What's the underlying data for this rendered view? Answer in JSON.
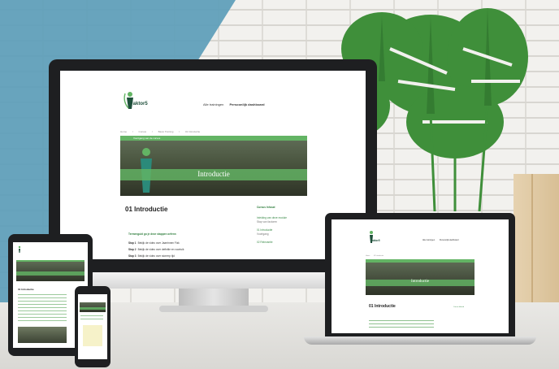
{
  "site": {
    "brand": "Faktor5",
    "nav": [
      {
        "label": "Alle trainingen"
      },
      {
        "label": "Persoonlijk dashboard"
      }
    ],
    "breadcrumbs": [
      "Home",
      "/",
      "Cursus",
      "/",
      "Basis Training",
      "/",
      "01 Introductie"
    ],
    "progress_label": "Voortgang van de cursus",
    "hero_title": "Introductie",
    "page_title": "01 Introductie",
    "subhead": "Termenguid go je deze stappen oefenn",
    "steps": [
      {
        "label": "Stap 1",
        "text": "Bekijk de video over Jaarrinnen Fizk"
      },
      {
        "label": "Stap 2",
        "text": "Bekijk de video over definitie en voortuik"
      },
      {
        "label": "Stap 3",
        "text": "Bekijk de video over storrerp tijd"
      }
    ],
    "sidebar": {
      "heading": "Cursus Inhoud",
      "items": [
        {
          "label": "Inleiding van deze module",
          "meta": "Stap van factoren"
        },
        {
          "label": "01 Introductie",
          "meta": "Voortgang"
        },
        {
          "label": "02 Relevantie",
          "meta": ""
        }
      ]
    }
  },
  "colors": {
    "accent_green": "#63b464",
    "brand_dark": "#1e4f3a",
    "wall_stripe": "#5c9db8"
  }
}
